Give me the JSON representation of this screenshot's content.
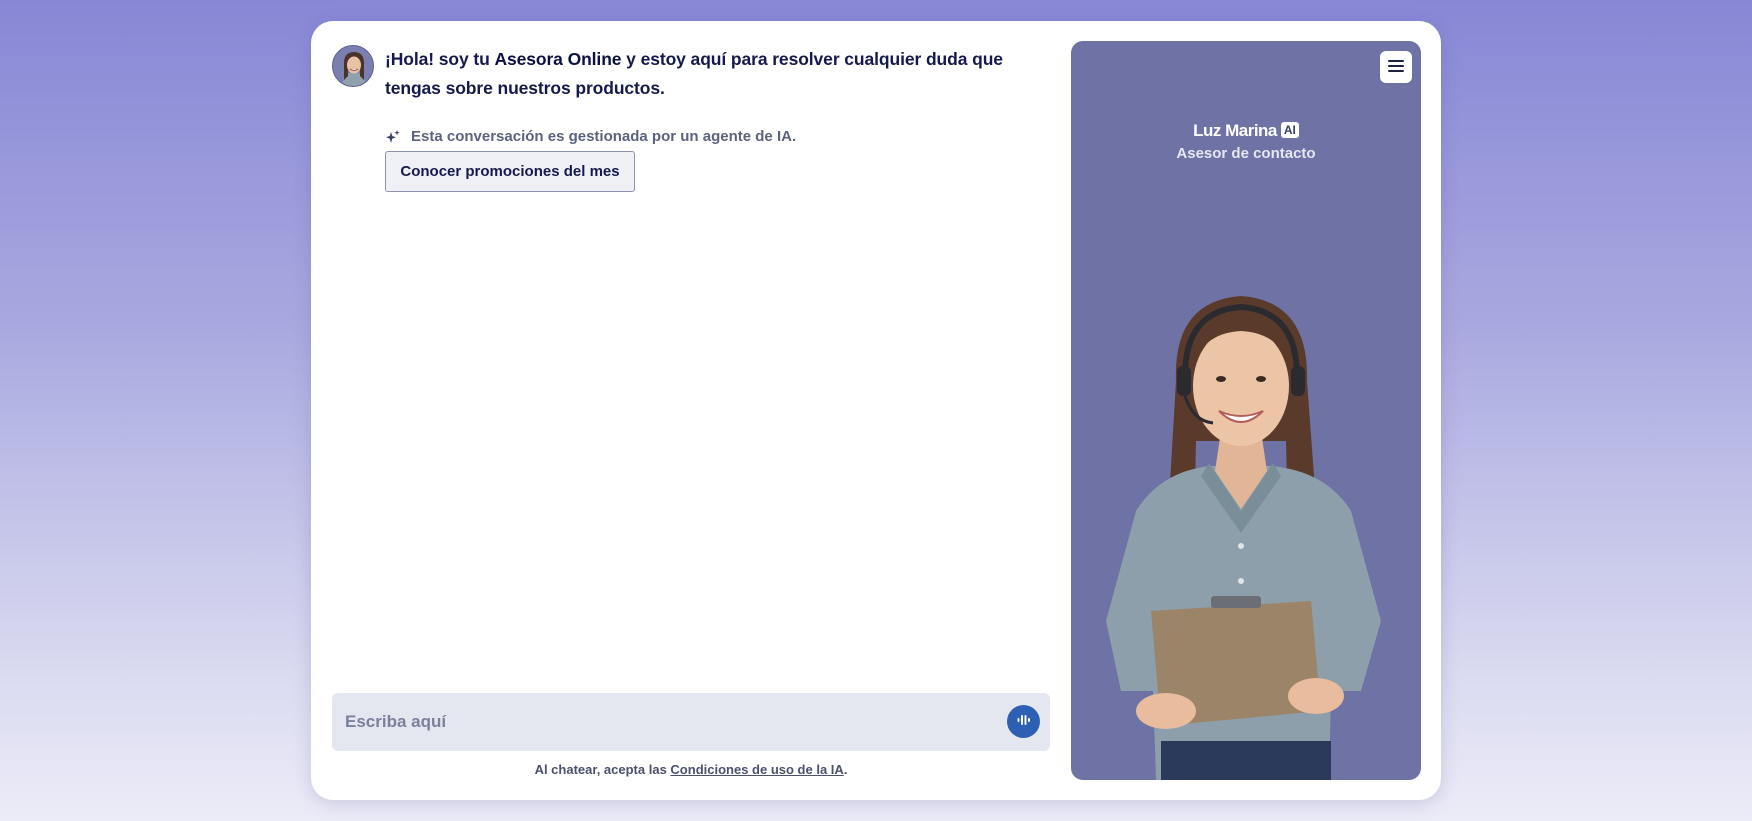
{
  "chat": {
    "greeting_prefix": "¡Hola! soy tu ",
    "greeting_bold": "Asesora Online",
    "greeting_suffix": " y estoy aquí para resolver cualquier duda que tengas sobre nuestros productos.",
    "ai_notice": "Esta conversación es gestionada por un agente de IA.",
    "quick_reply": "Conocer promociones del mes"
  },
  "composer": {
    "placeholder": "Escriba aquí",
    "value": ""
  },
  "footer": {
    "terms_prefix": "Al chatear, acepta las ",
    "terms_link": "Condiciones de uso de la IA",
    "terms_suffix": "."
  },
  "agent": {
    "name": "Luz Marina",
    "badge": "AI",
    "role": "Asesor de contacto"
  },
  "icons": {
    "sparkle": "sparkle-icon",
    "voice": "voice-wave-icon",
    "menu": "hamburger-menu-icon"
  },
  "colors": {
    "background_top": "#8787d6",
    "panel": "#6e72a4",
    "voice_button": "#2d5fb3",
    "heading_text": "#151a4c"
  }
}
